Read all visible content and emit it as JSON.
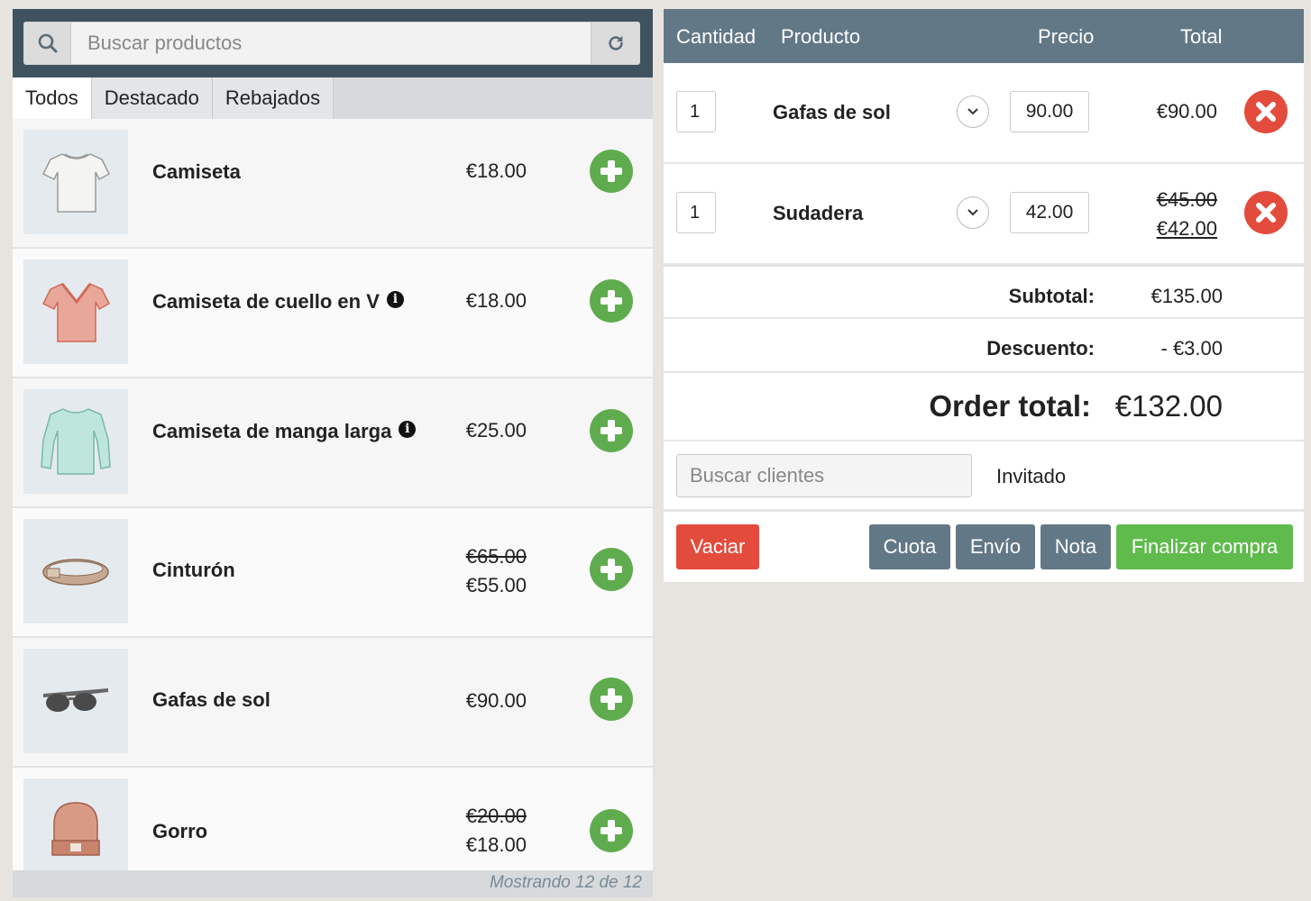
{
  "search": {
    "placeholder": "Buscar productos"
  },
  "tabs": [
    {
      "label": "Todos",
      "active": true
    },
    {
      "label": "Destacado",
      "active": false
    },
    {
      "label": "Rebajados",
      "active": false
    }
  ],
  "products": [
    {
      "name": "Camiseta",
      "price": "€18.00",
      "old_price": "",
      "info": false,
      "thumb": "tshirt-grey"
    },
    {
      "name": "Camiseta de cuello en V",
      "price": "€18.00",
      "old_price": "",
      "info": true,
      "thumb": "vneck-orange"
    },
    {
      "name": "Camiseta de manga larga",
      "price": "€25.00",
      "old_price": "",
      "info": true,
      "thumb": "longsleeve-mint"
    },
    {
      "name": "Cinturón",
      "price": "€55.00",
      "old_price": "€65.00",
      "info": false,
      "thumb": "belt"
    },
    {
      "name": "Gafas de sol",
      "price": "€90.00",
      "old_price": "",
      "info": false,
      "thumb": "sunglasses"
    },
    {
      "name": "Gorro",
      "price": "€18.00",
      "old_price": "€20.00",
      "info": false,
      "thumb": "beanie"
    }
  ],
  "footer": {
    "status": "Mostrando 12 de 12"
  },
  "cart": {
    "headers": {
      "qty": "Cantidad",
      "product": "Producto",
      "price": "Precio",
      "total": "Total"
    },
    "items": [
      {
        "qty": "1",
        "name": "Gafas de sol",
        "price": "90.00",
        "total": "€90.00",
        "old_total": ""
      },
      {
        "qty": "1",
        "name": "Sudadera",
        "price": "42.00",
        "total": "€42.00",
        "old_total": "€45.00"
      }
    ],
    "subtotal_label": "Subtotal:",
    "subtotal": "€135.00",
    "discount_label": "Descuento:",
    "discount": "- €3.00",
    "order_total_label": "Order total:",
    "order_total": "€132.00"
  },
  "customer": {
    "placeholder": "Buscar clientes",
    "guest_label": "Invitado"
  },
  "actions": {
    "clear": "Vaciar",
    "fee": "Cuota",
    "shipping": "Envío",
    "note": "Nota",
    "checkout": "Finalizar compra"
  },
  "colors": {
    "header_dark": "#3f5260",
    "cart_header": "#627887",
    "add_green": "#5fac4e",
    "remove_red": "#e34b3c",
    "checkout_green": "#5fbb4c"
  }
}
